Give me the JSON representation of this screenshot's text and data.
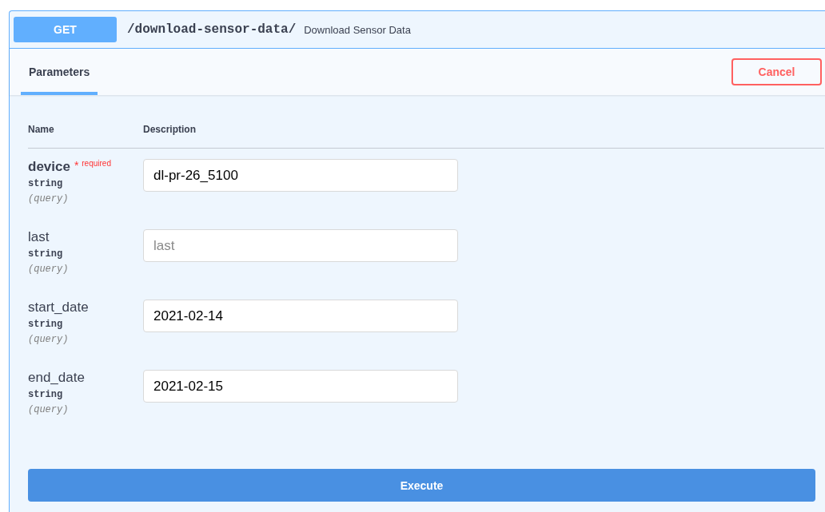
{
  "operation": {
    "method": "GET",
    "path": "/download-sensor-data/",
    "summary": "Download Sensor Data"
  },
  "tabs": [
    {
      "label": "Parameters",
      "selected": true
    }
  ],
  "cancel_button": "Cancel",
  "columns": [
    "Name",
    "Description"
  ],
  "parameters": [
    {
      "name": "device",
      "required": true,
      "required_mark": "*",
      "required_label": "required",
      "type": "string",
      "location": "(query)",
      "value": "dl-pr-26_5100"
    },
    {
      "name": "last",
      "required": false,
      "type": "string",
      "location": "(query)",
      "placeholder": "last"
    },
    {
      "name": "start_date",
      "required": false,
      "type": "string",
      "location": "(query)",
      "value": "2021-02-14"
    },
    {
      "name": "end_date",
      "required": false,
      "type": "string",
      "location": "(query)",
      "value": "2021-02-15"
    }
  ],
  "execute_button": "Execute"
}
